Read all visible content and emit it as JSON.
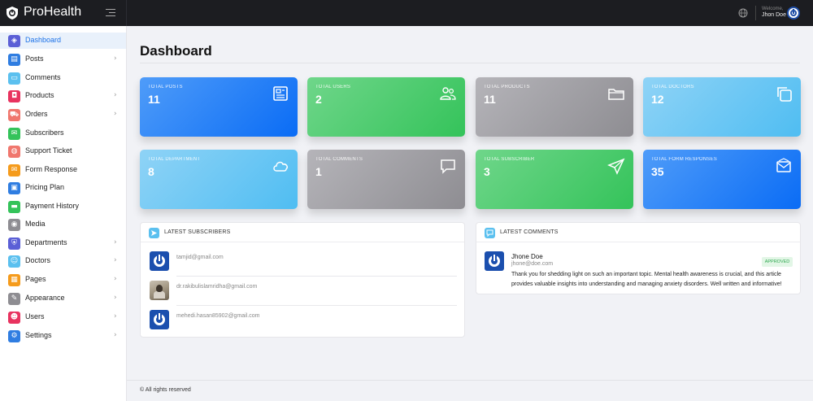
{
  "app": {
    "name": "ProHealth"
  },
  "header": {
    "welcome": "Welcome,",
    "username": "Jhon Doe"
  },
  "sidebar": {
    "items": [
      {
        "label": "Dashboard",
        "color": "#5b5fd6",
        "icon": "cube-icon",
        "glyph": "◈",
        "chevron": false,
        "active": true
      },
      {
        "label": "Posts",
        "color": "#2f7de1",
        "icon": "newspaper-icon",
        "glyph": "▤",
        "chevron": true
      },
      {
        "label": "Comments",
        "color": "#5bc0ef",
        "icon": "comment-icon",
        "glyph": "▭",
        "chevron": false
      },
      {
        "label": "Products",
        "color": "#e8335f",
        "icon": "shopping-bag-icon",
        "glyph": "◘",
        "chevron": true
      },
      {
        "label": "Orders",
        "color": "#f0776e",
        "icon": "cart-icon",
        "glyph": "⛟",
        "chevron": true
      },
      {
        "label": "Subscribers",
        "color": "#34c35a",
        "icon": "mail-open-icon",
        "glyph": "✉",
        "chevron": false
      },
      {
        "label": "Support Ticket",
        "color": "#f0776e",
        "icon": "support-chat-icon",
        "glyph": "◍",
        "chevron": false
      },
      {
        "label": "Form Response",
        "color": "#f59b1c",
        "icon": "envelope-icon",
        "glyph": "✉",
        "chevron": false
      },
      {
        "label": "Pricing Plan",
        "color": "#2f7de1",
        "icon": "pricing-icon",
        "glyph": "▣",
        "chevron": false
      },
      {
        "label": "Payment History",
        "color": "#34c35a",
        "icon": "credit-card-icon",
        "glyph": "▬",
        "chevron": false
      },
      {
        "label": "Media",
        "color": "#8e8d92",
        "icon": "camera-icon",
        "glyph": "◉",
        "chevron": false
      },
      {
        "label": "Departments",
        "color": "#5b5fd6",
        "icon": "shield-icon",
        "glyph": "⛨",
        "chevron": true
      },
      {
        "label": "Doctors",
        "color": "#5bc0ef",
        "icon": "users-icon",
        "glyph": "☺",
        "chevron": true
      },
      {
        "label": "Pages",
        "color": "#f59b1c",
        "icon": "pages-icon",
        "glyph": "▦",
        "chevron": true
      },
      {
        "label": "Appearance",
        "color": "#8e8d92",
        "icon": "brush-icon",
        "glyph": "✎",
        "chevron": true
      },
      {
        "label": "Users",
        "color": "#e8335f",
        "icon": "user-group-icon",
        "glyph": "☻",
        "chevron": true
      },
      {
        "label": "Settings",
        "color": "#2f7de1",
        "icon": "gear-icon",
        "glyph": "⚙",
        "chevron": true
      }
    ]
  },
  "main": {
    "title": "Dashboard",
    "cards": [
      {
        "label": "TOTAL POSTS",
        "value": "11",
        "theme": "blue",
        "icon": "newspaper-icon"
      },
      {
        "label": "TOTAL USERS",
        "value": "2",
        "theme": "green",
        "icon": "users-icon"
      },
      {
        "label": "TOTAL PRODUCTS",
        "value": "11",
        "theme": "gray",
        "icon": "folder-icon"
      },
      {
        "label": "TOTAL DOCTORS",
        "value": "12",
        "theme": "sky",
        "icon": "copy-icon"
      },
      {
        "label": "TOTAL DEPARTMENT",
        "value": "8",
        "theme": "sky",
        "icon": "cloud-icon"
      },
      {
        "label": "TOTAL COMMENTS",
        "value": "1",
        "theme": "gray",
        "icon": "chat-bubble-icon"
      },
      {
        "label": "TOTAL SUBSCRIBER",
        "value": "3",
        "theme": "green",
        "icon": "paper-plane-icon"
      },
      {
        "label": "TOTAL FORM RESPONSES",
        "value": "35",
        "theme": "blue",
        "icon": "envelope-icon"
      }
    ],
    "subscribers": {
      "title": "LATEST SUBSCRIBERS",
      "items": [
        {
          "email": "tamjid@gmail.com",
          "avatar": "power-logo"
        },
        {
          "email": "dr.rakibulislamridha@gmail.com",
          "avatar": "photo"
        },
        {
          "email": "mehedi.hasan85902@gmail.com",
          "avatar": "power-logo"
        }
      ]
    },
    "comments": {
      "title": "LATEST COMMENTS",
      "items": [
        {
          "name": "Jhone Doe",
          "email": "jhone@doe.com",
          "status": "APPROVED",
          "text": "Thank you for shedding light on such an important topic. Mental health awareness is crucial, and this article provides valuable insights into understanding and managing anxiety disorders. Well written and informative!"
        }
      ]
    }
  },
  "footer": {
    "text": "© All rights reserved"
  }
}
